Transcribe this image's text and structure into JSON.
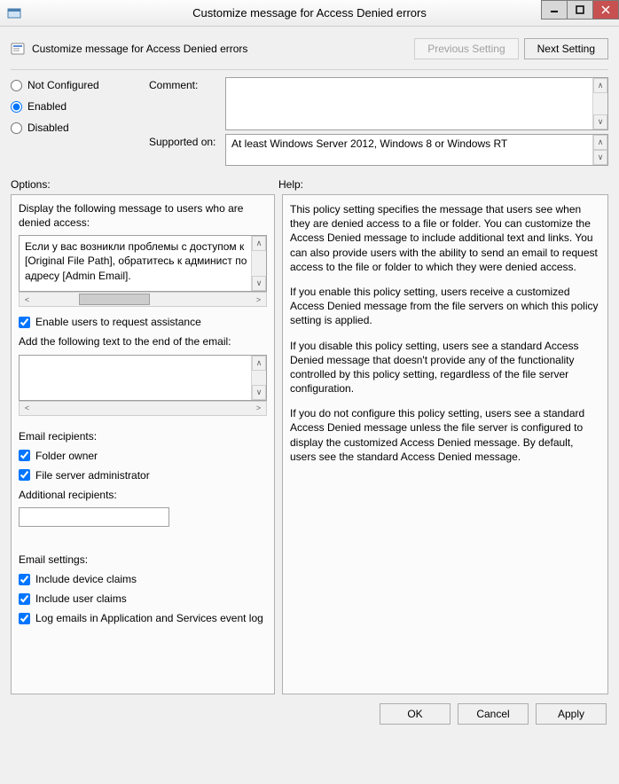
{
  "window": {
    "title": "Customize message for Access Denied errors"
  },
  "header": {
    "policy_title": "Customize message for Access Denied errors",
    "previous": "Previous Setting",
    "next": "Next Setting"
  },
  "state": {
    "not_configured_label": "Not Configured",
    "enabled_label": "Enabled",
    "disabled_label": "Disabled",
    "selected": "enabled"
  },
  "labels": {
    "comment": "Comment:",
    "supported_on": "Supported on:",
    "options": "Options:",
    "help": "Help:"
  },
  "supported_text": "At least Windows Server 2012, Windows 8 or Windows RT",
  "options": {
    "display_message_label": "Display the following message to users who are denied access:",
    "display_message_value": "Если у вас возникли проблемы с доступом к [Original File Path], обратитесь к админист по адресу [Admin Email].",
    "enable_assist_label": "Enable users to request assistance",
    "enable_assist_checked": true,
    "append_email_label": "Add the following text to the end of the email:",
    "append_email_value": "",
    "recipients_heading": "Email recipients:",
    "folder_owner_label": "Folder owner",
    "folder_owner_checked": true,
    "fs_admin_label": "File server administrator",
    "fs_admin_checked": true,
    "additional_recipients_label": "Additional recipients:",
    "additional_recipients_value": "",
    "email_settings_heading": "Email settings:",
    "include_device_claims_label": "Include device claims",
    "include_device_claims_checked": true,
    "include_user_claims_label": "Include user claims",
    "include_user_claims_checked": true,
    "log_emails_label": "Log emails in Application and Services event log",
    "log_emails_checked": true
  },
  "help": {
    "p1": "This policy setting specifies the message that users see when they are denied access to a file or folder. You can customize the Access Denied message to include additional text and links. You can also provide users with the ability to send an email to request access to the file or folder to which they were denied access.",
    "p2": "If you enable this policy setting, users receive a customized Access Denied message from the file servers on which this policy setting is applied.",
    "p3": "If you disable this policy setting, users see a standard Access Denied message that doesn't provide any of the functionality controlled by this policy setting, regardless of the file server configuration.",
    "p4": "If you do not configure this policy setting, users see a standard Access Denied message unless the file server is configured to display the customized Access Denied message. By default, users see the standard Access Denied message."
  },
  "footer": {
    "ok": "OK",
    "cancel": "Cancel",
    "apply": "Apply"
  }
}
